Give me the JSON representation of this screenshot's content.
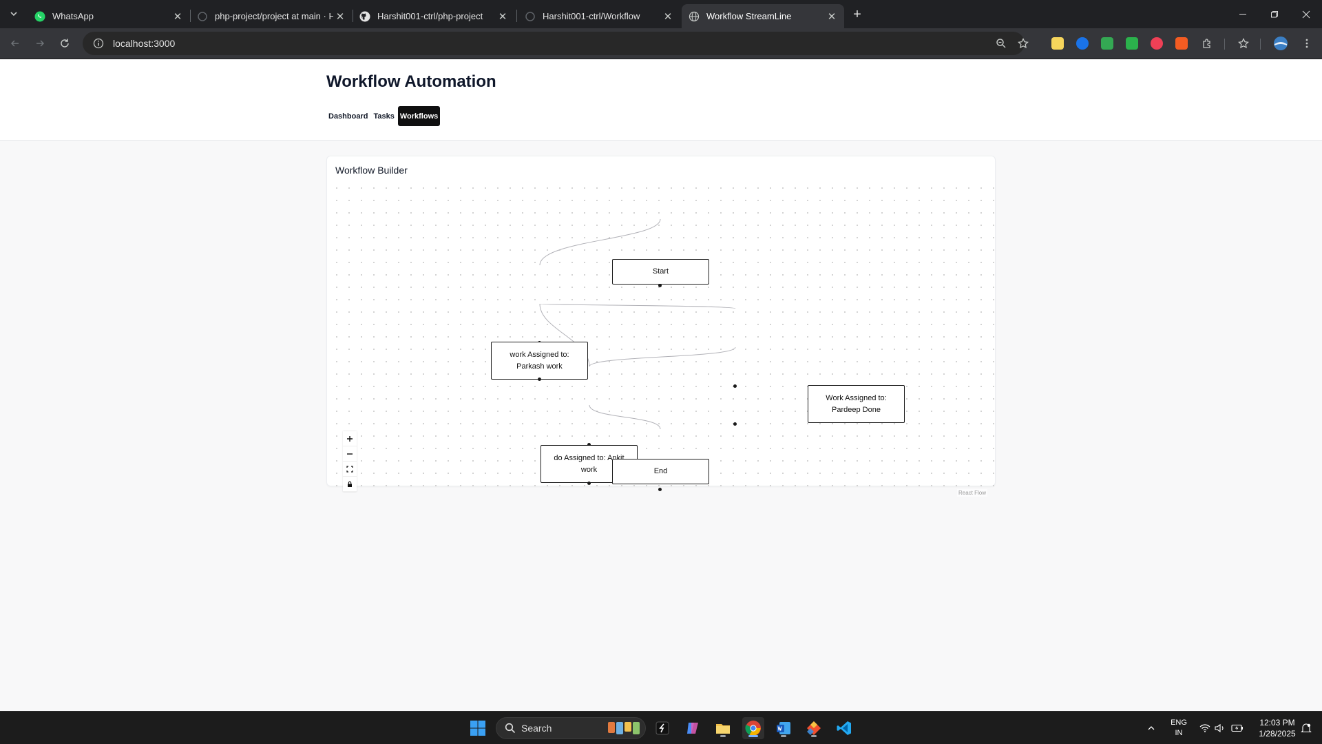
{
  "browser": {
    "tabs": [
      {
        "title": "WhatsApp",
        "active": false
      },
      {
        "title": "php-project/project at main · H",
        "active": false
      },
      {
        "title": "Harshit001-ctrl/php-project",
        "active": false
      },
      {
        "title": "Harshit001-ctrl/Workflow",
        "active": false
      },
      {
        "title": "Workflow StreamLine",
        "active": true
      }
    ],
    "close_glyph": "✕",
    "new_tab_glyph": "+",
    "url": "localhost:3000"
  },
  "app": {
    "title": "Workflow Automation",
    "nav": [
      {
        "label": "Dashboard",
        "active": false
      },
      {
        "label": "Tasks",
        "active": false
      },
      {
        "label": "Workflows",
        "active": true
      }
    ]
  },
  "builder": {
    "title": "Workflow Builder",
    "nodes": [
      {
        "id": "start",
        "label": "Start"
      },
      {
        "id": "parkash",
        "label": "work Assigned to: Parkash work"
      },
      {
        "id": "pardeep",
        "label": "Work Assigned to: Pardeep Done"
      },
      {
        "id": "ankit",
        "label": "do Assigned to: Ankit work"
      },
      {
        "id": "end",
        "label": "End"
      }
    ],
    "edges": [
      {
        "from": "start",
        "to": "parkash"
      },
      {
        "from": "parkash",
        "to": "pardeep"
      },
      {
        "from": "parkash",
        "to": "ankit"
      },
      {
        "from": "pardeep",
        "to": "ankit"
      },
      {
        "from": "ankit",
        "to": "end"
      }
    ],
    "controls": [
      "zoom-in",
      "zoom-out",
      "fit-view",
      "lock"
    ],
    "attribution": "React Flow"
  },
  "taskbar": {
    "search_placeholder": "Search",
    "language": "ENG",
    "region": "IN",
    "time": "12:03 PM",
    "date": "1/28/2025"
  }
}
